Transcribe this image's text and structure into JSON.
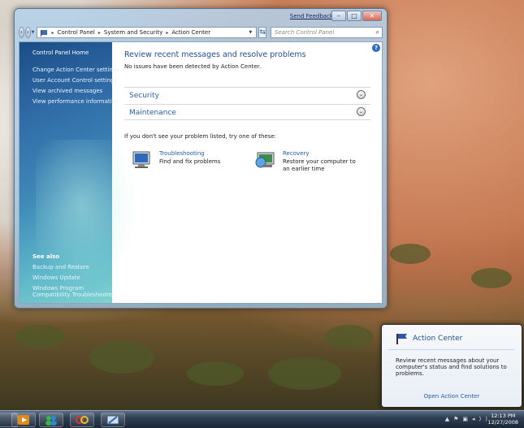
{
  "window": {
    "send_feedback": "Send Feedback",
    "minimize": "–",
    "maximize": "□",
    "close": "✕",
    "breadcrumb": [
      "Control Panel",
      "System and Security",
      "Action Center"
    ],
    "search_placeholder": "Search Control Panel"
  },
  "sidebar": {
    "home": "Control Panel Home",
    "links": [
      {
        "label": "Change Action Center settings"
      },
      {
        "label": "User Account Control settings"
      },
      {
        "label": "View archived messages"
      },
      {
        "label": "View performance information"
      }
    ],
    "see_also_title": "See also",
    "see_also": [
      {
        "label": "Backup and Restore"
      },
      {
        "label": "Windows Update"
      },
      {
        "label": "Windows Program"
      },
      {
        "label": "Compatibility Troubleshooter"
      }
    ]
  },
  "main": {
    "title": "Review recent messages and resolve problems",
    "subtitle": "No issues have been detected by Action Center.",
    "sections": [
      {
        "label": "Security"
      },
      {
        "label": "Maintenance"
      }
    ],
    "hint": "If you don't see your problem listed, try one of these:",
    "tools": [
      {
        "title": "Troubleshooting",
        "desc": "Find and fix problems",
        "icon": "troubleshooting-icon"
      },
      {
        "title": "Recovery",
        "desc": "Restore your computer to an earlier time",
        "icon": "recovery-icon"
      }
    ]
  },
  "notification": {
    "title": "Action Center",
    "message": "Review recent messages about your computer's status and find solutions to problems.",
    "link": "Open Action Center"
  },
  "taskbar": {
    "time": "12:13 PM",
    "date": "12/27/2008"
  },
  "colors": {
    "accent": "#1f4e9a",
    "link": "#2a62b0"
  }
}
